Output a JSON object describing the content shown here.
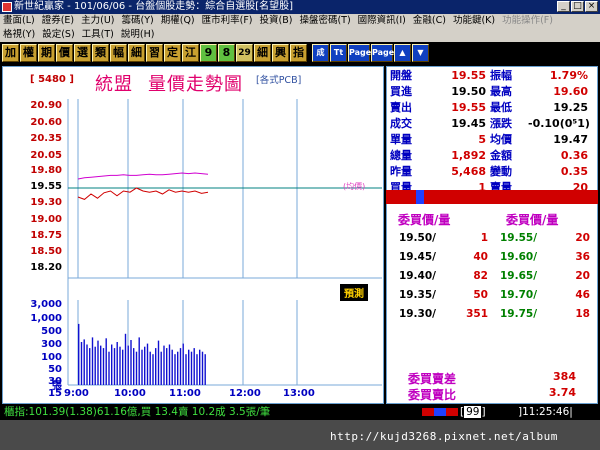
{
  "window": {
    "title": "新世紀贏家 - 101/06/06 - 台盤個股走勢：綜合自選股[名望股]",
    "min": "_",
    "max": "□",
    "close": "×"
  },
  "menu": {
    "row1": [
      "畫面(L)",
      "證券(E)",
      "主力(U)",
      "籌碼(Y)",
      "期權(Q)",
      "匯市利率(F)",
      "投資(B)",
      "操盤密碼(T)",
      "國際資訊(I)",
      "金融(C)",
      "功能鍵(K)",
      "功能操作(F)"
    ],
    "row1_disabled_index": 11,
    "row2": [
      "格視(Y)",
      "設定(S)",
      "工具(T)",
      "說明(H)"
    ]
  },
  "toolbar": {
    "buttons": [
      "加",
      "權",
      "期",
      "價",
      "選",
      "類",
      "幅",
      "細",
      "習",
      "定",
      "江",
      "9",
      "8",
      "29",
      "細",
      "興",
      "指"
    ],
    "icons": [
      "成",
      "Tt",
      "Page",
      "Page",
      "▲",
      "▼"
    ]
  },
  "chart": {
    "stock_code": "5480",
    "stock_name": "統盟",
    "chart_title": "量價走勢圖",
    "category_tag": "[各式PCB]",
    "avg_label": "(均價)",
    "tag": "預測",
    "units_label": "張"
  },
  "chart_data": {
    "type": "line",
    "price_ticks": [
      "20.90",
      "20.60",
      "20.35",
      "20.05",
      "19.80",
      "19.55",
      "19.30",
      "19.00",
      "18.75",
      "18.50",
      "18.20"
    ],
    "volume_ticks": [
      "3,000",
      "1,000",
      "500",
      "300",
      "100",
      "50",
      "30",
      "15"
    ],
    "x_ticks": [
      "9:00",
      "10:00",
      "11:00",
      "12:00",
      "13:00"
    ],
    "reference_price": 19.55,
    "series": [
      {
        "color": "#d000d0",
        "values": [
          19.7,
          19.72,
          19.73,
          19.74,
          19.75,
          19.76,
          19.76,
          19.77,
          19.76,
          19.76,
          19.77,
          19.78,
          19.77,
          19.77,
          19.78,
          19.79,
          19.8,
          19.79,
          19.8,
          19.79,
          19.78
        ]
      },
      {
        "color": "#d00000",
        "values": [
          19.4,
          19.36,
          19.45,
          19.38,
          19.47,
          19.5,
          19.42,
          19.5,
          19.48,
          19.55,
          19.5,
          19.48,
          19.5,
          19.45,
          19.52,
          19.48,
          19.5,
          19.48,
          19.5,
          19.46,
          19.48
        ]
      }
    ],
    "volume": [
      900,
      120,
      160,
      90,
      60,
      200,
      70,
      140,
      80,
      60,
      180,
      40,
      90,
      60,
      120,
      70,
      50,
      300,
      80,
      150,
      60,
      40,
      200,
      50,
      70,
      100,
      40,
      30,
      60,
      140,
      40,
      80,
      60,
      90,
      50,
      30,
      40,
      60,
      100,
      30,
      50,
      40,
      60,
      30,
      50,
      40,
      30
    ]
  },
  "quote": {
    "rows": [
      {
        "l1": "開盤",
        "v1": "19.55",
        "c1": "red",
        "l2": "振幅",
        "v2": "1.79%",
        "c2": "red"
      },
      {
        "l1": "買進",
        "v1": "19.50",
        "c1": "black",
        "l2": "最高",
        "v2": "19.60",
        "c2": "red"
      },
      {
        "l1": "賣出",
        "v1": "19.55",
        "c1": "red",
        "l2": "最低",
        "v2": "19.25",
        "c2": "black"
      },
      {
        "l1": "成交",
        "v1": "19.45",
        "c1": "black",
        "l2": "漲跌",
        "v2": "-0.10(0⁵1)",
        "c2": "black"
      },
      {
        "l1": "單量",
        "v1": "5",
        "c1": "red",
        "l2": "均價",
        "v2": "19.47",
        "c2": "black"
      },
      {
        "l1": "總量",
        "v1": "1,892",
        "c1": "red",
        "l2": "金額",
        "v2": "0.36",
        "c2": "red"
      },
      {
        "l1": "昨量",
        "v1": "5,468",
        "c1": "red",
        "l2": "變動",
        "v2": "0.35",
        "c2": "red"
      },
      {
        "l1": "買量",
        "v1": "1",
        "c1": "red",
        "l2": "賣量",
        "v2": "20",
        "c2": "red"
      }
    ],
    "book_bid_title": "委買價/量",
    "book_ask_title": "委買價/量",
    "book": [
      {
        "bid": "19.50/",
        "bq": "1",
        "ask": "19.55/",
        "aq": "20"
      },
      {
        "bid": "19.45/",
        "bq": "40",
        "ask": "19.60/",
        "aq": "36"
      },
      {
        "bid": "19.40/",
        "bq": "82",
        "ask": "19.65/",
        "aq": "20"
      },
      {
        "bid": "19.35/",
        "bq": "50",
        "ask": "19.70/",
        "aq": "46"
      },
      {
        "bid": "19.30/",
        "bq": "351",
        "ask": "19.75/",
        "aq": "18"
      }
    ],
    "diff_label": "委買賣差",
    "diff_value": "384",
    "ratio_label": "委買賣比",
    "ratio_value": "3.74"
  },
  "status": {
    "index_line": "櫃指:101.39(1.38)61.16億,買 13.4賣 10.2成 3.5張/筆",
    "page_num": "99",
    "time": "11:25:46"
  },
  "watermark": "http://kujd3268.pixnet.net/album"
}
